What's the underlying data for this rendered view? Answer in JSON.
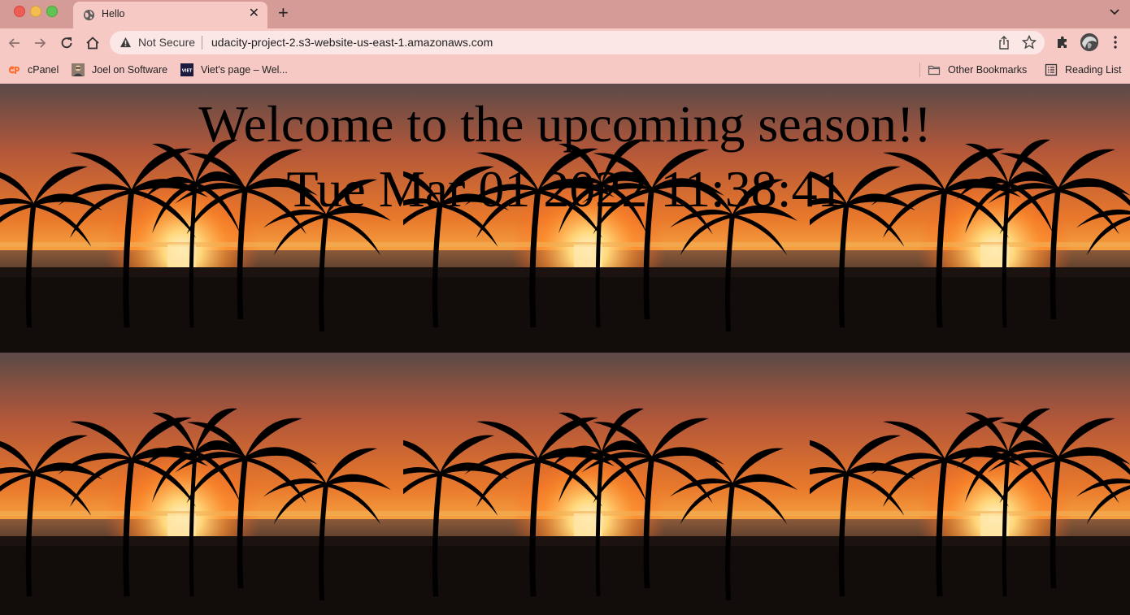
{
  "window": {
    "tab_title": "Hello",
    "close_label": "✕",
    "new_tab_label": "+"
  },
  "toolbar": {
    "security_label": "Not Secure",
    "url": "udacity-project-2.s3-website-us-east-1.amazonaws.com"
  },
  "bookmarks": {
    "items": [
      {
        "label": "cPanel",
        "icon": "cpanel-icon"
      },
      {
        "label": "Joel on Software",
        "icon": "joel-avatar-icon"
      },
      {
        "label": "Viet's page – Wel...",
        "icon": "viet-icon"
      }
    ],
    "other_label": "Other Bookmarks",
    "reading_list_label": "Reading List"
  },
  "page": {
    "heading": "Welcome to the upcoming season!!",
    "datetime": "Tue Mar 01 2022 11:38:41",
    "background_image": "sunset-palm-trees-tile",
    "colors": {
      "tab_strip": "#d59b97",
      "toolbar": "#f6c9c5",
      "omnibox": "#fbe7e5"
    }
  }
}
